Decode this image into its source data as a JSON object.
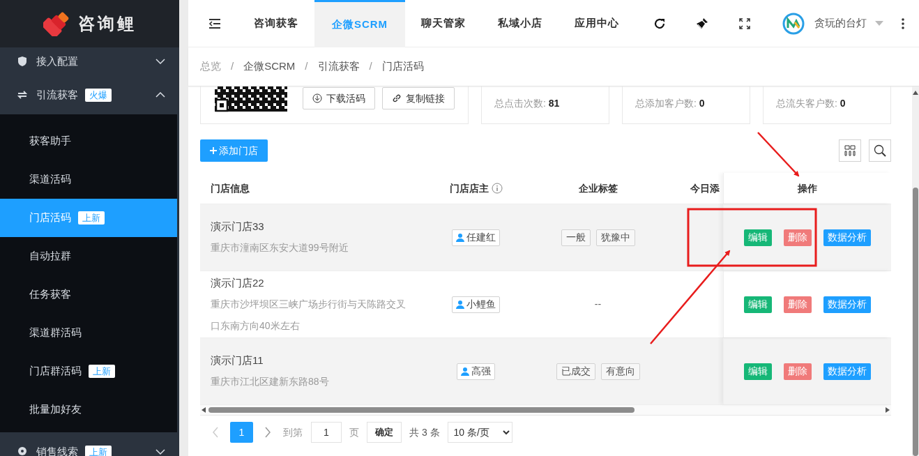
{
  "logo": {
    "text": "咨询鲤"
  },
  "sidebar": {
    "groups": [
      {
        "label": "接入配置",
        "expanded": false
      },
      {
        "label": "引流获客",
        "badge": "火爆",
        "expanded": true,
        "children": [
          {
            "label": "获客助手",
            "selected": false
          },
          {
            "label": "渠道活码",
            "selected": false
          },
          {
            "label": "门店活码",
            "badge": "上新",
            "selected": true
          },
          {
            "label": "自动拉群",
            "selected": false
          },
          {
            "label": "任务获客",
            "selected": false
          },
          {
            "label": "渠道群活码",
            "selected": false
          },
          {
            "label": "门店群活码",
            "badge": "上新",
            "selected": false
          },
          {
            "label": "批量加好友",
            "selected": false
          }
        ]
      },
      {
        "label": "销售线索",
        "badge": "上新",
        "expanded": false
      }
    ]
  },
  "top_tabs": [
    {
      "label": "咨询获客",
      "selected": false
    },
    {
      "label": "企微SCRM",
      "selected": true
    },
    {
      "label": "聊天管家",
      "selected": false
    },
    {
      "label": "私域小店",
      "selected": false
    },
    {
      "label": "应用中心",
      "selected": false
    }
  ],
  "user": {
    "name": "贪玩的台灯"
  },
  "breadcrumb": {
    "items": [
      "总览",
      "企微SCRM",
      "引流获客",
      "门店活码"
    ],
    "separator": "/"
  },
  "qr_card": {
    "buttons": [
      {
        "kind": "download",
        "label": "下载活码"
      },
      {
        "kind": "link",
        "label": "复制链接"
      }
    ]
  },
  "stats": [
    {
      "label": "总点击次数:",
      "value": "81"
    },
    {
      "label": "总添加客户数:",
      "value": "0"
    },
    {
      "label": "总流失客户数:",
      "value": "0"
    }
  ],
  "add_button": "添加门店",
  "table": {
    "columns": [
      {
        "label": "门店信息",
        "info": false
      },
      {
        "label": "门店店主",
        "info": true
      },
      {
        "label": "企业标签",
        "info": false
      },
      {
        "label": "今日添",
        "info": false
      },
      {
        "label": "操作",
        "info": false
      }
    ],
    "rows": [
      {
        "highlighted": true,
        "name": "演示门店33",
        "address": "重庆市潼南区东安大道99号附近",
        "owner": "任建红",
        "tags": [
          "一般",
          "犹豫中"
        ],
        "actions": [
          {
            "kind": "edit",
            "label": "编辑"
          },
          {
            "kind": "delete",
            "label": "删除"
          },
          {
            "kind": "analyze",
            "label": "数据分析"
          }
        ]
      },
      {
        "highlighted": false,
        "name": "演示门店22",
        "address": "重庆市沙坪坝区三峡广场步行街与天陈路交叉口东南方向40米左右",
        "owner": "小鲤鱼",
        "tags_text": "--",
        "actions": [
          {
            "kind": "edit",
            "label": "编辑"
          },
          {
            "kind": "delete",
            "label": "删除"
          },
          {
            "kind": "analyze",
            "label": "数据分析"
          }
        ]
      },
      {
        "highlighted": true,
        "name": "演示门店11",
        "address": "重庆市江北区建新东路88号",
        "owner": "高强",
        "tags": [
          "已成交",
          "有意向"
        ],
        "actions": [
          {
            "kind": "edit",
            "label": "编辑"
          },
          {
            "kind": "delete",
            "label": "删除"
          },
          {
            "kind": "analyze",
            "label": "数据分析"
          }
        ]
      }
    ]
  },
  "pagination": {
    "pages": [
      {
        "label": "1",
        "selected": true
      }
    ],
    "prev_disabled": true,
    "goto_label": "到第",
    "goto_value": "1",
    "page_unit": "页",
    "confirm": "确定",
    "total": "共 3 条",
    "page_size": "10 条/页"
  }
}
